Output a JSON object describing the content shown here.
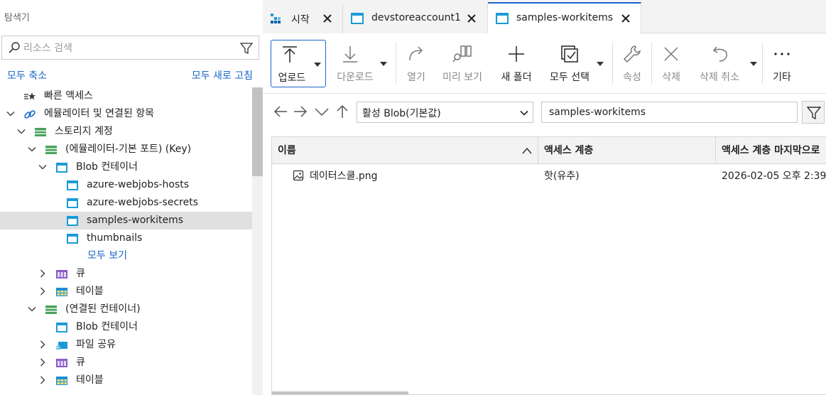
{
  "explorer": {
    "title": "탐색기",
    "search_placeholder": "리소스 검색",
    "collapse_all": "모두 축소",
    "refresh_all": "모두 새로 고침",
    "tree": [
      {
        "label": "빠른 액세스",
        "icon": "quick-access-icon"
      },
      {
        "label": "에뮬레이터 및 연결된 항목",
        "icon": "link-icon",
        "expanded": true
      },
      {
        "label": "스토리지 계정",
        "icon": "storage-account-icon",
        "expanded": true
      },
      {
        "label": "(에뮬레이터-기본 포트) (Key)",
        "icon": "storage-account-icon",
        "expanded": true
      },
      {
        "label": "Blob 컨테이너",
        "icon": "blob-container-icon",
        "expanded": true
      },
      {
        "label": "azure-webjobs-hosts",
        "icon": "blob-container-icon"
      },
      {
        "label": "azure-webjobs-secrets",
        "icon": "blob-container-icon"
      },
      {
        "label": "samples-workitems",
        "icon": "blob-container-icon",
        "selected": true
      },
      {
        "label": "thumbnails",
        "icon": "blob-container-icon"
      },
      {
        "label": "모두 보기",
        "link": true
      },
      {
        "label": "큐",
        "icon": "queue-icon",
        "expanded": false
      },
      {
        "label": "테이블",
        "icon": "table-icon",
        "expanded": false
      },
      {
        "label": "(연결된 컨테이너)",
        "icon": "storage-account-icon",
        "expanded": true
      },
      {
        "label": "Blob 컨테이너",
        "icon": "blob-container-icon"
      },
      {
        "label": "파일 공유",
        "icon": "file-share-icon",
        "expanded": false
      },
      {
        "label": "큐",
        "icon": "queue-icon",
        "expanded": false
      },
      {
        "label": "테이블",
        "icon": "table-icon",
        "expanded": false
      }
    ]
  },
  "tabs": [
    {
      "label": "시작",
      "icon": "start-icon"
    },
    {
      "label": "devstoreaccount1",
      "icon": "blob-container-icon"
    },
    {
      "label": "samples-workitems",
      "icon": "blob-container-icon",
      "active": true
    }
  ],
  "toolbar": {
    "upload": "업로드",
    "download": "다운로드",
    "open": "열기",
    "preview": "미리 보기",
    "new_folder": "새 폴더",
    "select_all": "모두 선택",
    "properties": "속성",
    "delete": "삭제",
    "undelete": "삭제 취소",
    "more": "기타"
  },
  "nav": {
    "access_filter": "활성 Blob(기본값)",
    "path": "samples-workitems"
  },
  "grid": {
    "columns": [
      "이름",
      "액세스 계층",
      "액세스 계층 마지막으로"
    ],
    "rows": [
      {
        "name": "데이터스쿨.png",
        "tier": "핫(유추)",
        "modified": "2026-02-05 오후 2:39"
      }
    ]
  },
  "colors": {
    "accent": "#1e64c8",
    "link": "#1666c7",
    "selected_row": "#e0e0e0",
    "container_icon": "#1a9bd7"
  }
}
